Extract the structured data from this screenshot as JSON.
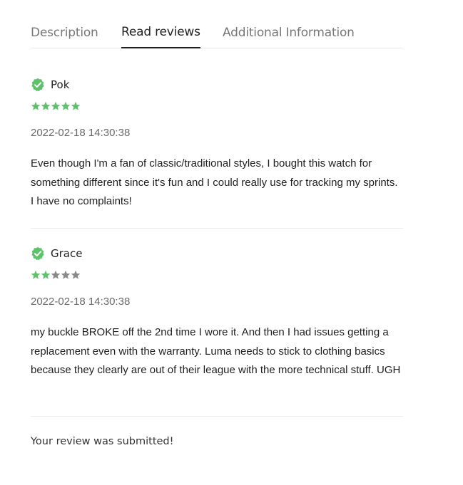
{
  "tabs": [
    {
      "label": "Description",
      "active": false
    },
    {
      "label": "Read reviews",
      "active": true
    },
    {
      "label": "Additional Information",
      "active": false
    }
  ],
  "colors": {
    "star_filled": "#5ec26a",
    "star_empty": "#8a8a8a",
    "verified_badge": "#5ec26a"
  },
  "reviews": [
    {
      "author": "Pok",
      "verified_icon": "verified-check-badge",
      "rating": 5,
      "max_rating": 5,
      "date": "2022-02-18 14:30:38",
      "text": "Even though I'm a fan of classic/traditional styles, I bought this watch for something different since it's fun and I could really use for tracking my sprints. I have no complaints!"
    },
    {
      "author": "Grace",
      "verified_icon": "verified-check-badge",
      "rating": 2,
      "max_rating": 5,
      "date": "2022-02-18 14:30:38",
      "text": "my buckle BROKE off the 2nd time I wore it. And then I had issues getting a replacement even with the warranty. Luma needs to stick to clothing basics because they clearly are out of their league with the more technical stuff. UGH"
    }
  ],
  "status": {
    "submitted_message": "Your review was submitted!"
  }
}
